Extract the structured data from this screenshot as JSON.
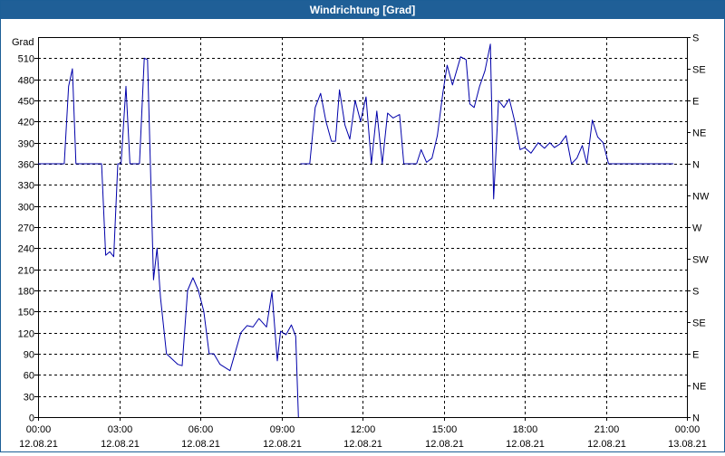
{
  "window": {
    "title": "Windrichtung [Grad]"
  },
  "chart_data": {
    "type": "line",
    "title": "Windrichtung [Grad]",
    "ylabel": "Grad",
    "ylim": [
      0,
      540
    ],
    "yticks": [
      0,
      30,
      60,
      90,
      120,
      150,
      180,
      210,
      240,
      270,
      300,
      330,
      360,
      390,
      420,
      450,
      480,
      510
    ],
    "right_axis_labels": [
      "N",
      "NE",
      "E",
      "SE",
      "S",
      "SW",
      "W",
      "NW",
      "N",
      "NE",
      "E",
      "SE",
      "S"
    ],
    "xlim_hours": [
      0,
      24
    ],
    "x_ticks": [
      {
        "time": "00:00",
        "date": "12.08.21"
      },
      {
        "time": "03:00",
        "date": "12.08.21"
      },
      {
        "time": "06:00",
        "date": "12.08.21"
      },
      {
        "time": "09:00",
        "date": "12.08.21"
      },
      {
        "time": "12:00",
        "date": "12.08.21"
      },
      {
        "time": "15:00",
        "date": "12.08.21"
      },
      {
        "time": "18:00",
        "date": "12.08.21"
      },
      {
        "time": "21:00",
        "date": "12.08.21"
      },
      {
        "time": "00:00",
        "date": "13.08.21"
      }
    ],
    "grid": true,
    "line_color": "#0000aa",
    "series": [
      {
        "segments": [
          [
            [
              0.0,
              360
            ],
            [
              0.97,
              360
            ],
            [
              1.13,
              470
            ],
            [
              1.27,
              495
            ],
            [
              1.4,
              360
            ],
            [
              2.35,
              360
            ],
            [
              2.5,
              230
            ],
            [
              2.65,
              235
            ],
            [
              2.8,
              228
            ],
            [
              2.95,
              360
            ],
            [
              3.07,
              360
            ],
            [
              3.25,
              470
            ],
            [
              3.4,
              360
            ],
            [
              3.75,
              360
            ],
            [
              3.93,
              510
            ],
            [
              4.05,
              508
            ],
            [
              4.27,
              195
            ],
            [
              4.4,
              240
            ],
            [
              4.53,
              170
            ],
            [
              4.75,
              90
            ],
            [
              5.17,
              75
            ],
            [
              5.33,
              73
            ],
            [
              5.53,
              180
            ],
            [
              5.73,
              198
            ],
            [
              5.93,
              180
            ],
            [
              6.13,
              150
            ],
            [
              6.33,
              90
            ],
            [
              6.5,
              90
            ],
            [
              6.73,
              75
            ],
            [
              7.1,
              66
            ],
            [
              7.5,
              120
            ],
            [
              7.73,
              130
            ],
            [
              7.95,
              128
            ],
            [
              8.17,
              140
            ],
            [
              8.45,
              128
            ],
            [
              8.65,
              178
            ],
            [
              8.85,
              80
            ],
            [
              8.97,
              122
            ],
            [
              9.17,
              117
            ],
            [
              9.37,
              131
            ],
            [
              9.53,
              115
            ],
            [
              9.63,
              0
            ]
          ],
          [
            [
              9.7,
              360
            ],
            [
              10.05,
              360
            ],
            [
              10.25,
              440
            ],
            [
              10.45,
              460
            ],
            [
              10.65,
              420
            ],
            [
              10.85,
              392
            ],
            [
              11.0,
              392
            ],
            [
              11.15,
              465
            ],
            [
              11.35,
              415
            ],
            [
              11.53,
              395
            ],
            [
              11.73,
              450
            ],
            [
              11.93,
              420
            ],
            [
              12.13,
              455
            ],
            [
              12.33,
              360
            ],
            [
              12.53,
              435
            ],
            [
              12.73,
              360
            ],
            [
              12.93,
              432
            ],
            [
              13.13,
              425
            ],
            [
              13.37,
              430
            ],
            [
              13.53,
              360
            ],
            [
              14.0,
              360
            ],
            [
              14.17,
              380
            ],
            [
              14.37,
              362
            ],
            [
              14.57,
              368
            ],
            [
              14.77,
              400
            ],
            [
              14.97,
              460
            ],
            [
              15.13,
              500
            ],
            [
              15.33,
              472
            ],
            [
              15.63,
              512
            ],
            [
              15.83,
              508
            ],
            [
              15.97,
              445
            ],
            [
              16.13,
              440
            ],
            [
              16.33,
              470
            ],
            [
              16.53,
              492
            ],
            [
              16.73,
              530
            ],
            [
              16.85,
              310
            ],
            [
              17.03,
              450
            ],
            [
              17.23,
              440
            ],
            [
              17.43,
              452
            ],
            [
              17.63,
              420
            ],
            [
              17.83,
              380
            ],
            [
              18.0,
              383
            ],
            [
              18.23,
              375
            ],
            [
              18.5,
              390
            ],
            [
              18.73,
              382
            ],
            [
              18.93,
              390
            ],
            [
              19.1,
              383
            ],
            [
              19.3,
              388
            ],
            [
              19.53,
              400
            ],
            [
              19.73,
              360
            ],
            [
              19.93,
              368
            ],
            [
              20.13,
              386
            ],
            [
              20.3,
              360
            ],
            [
              20.5,
              422
            ],
            [
              20.7,
              398
            ],
            [
              20.9,
              390
            ],
            [
              21.1,
              360
            ],
            [
              21.3,
              360
            ],
            [
              23.5,
              360
            ]
          ]
        ]
      }
    ]
  }
}
